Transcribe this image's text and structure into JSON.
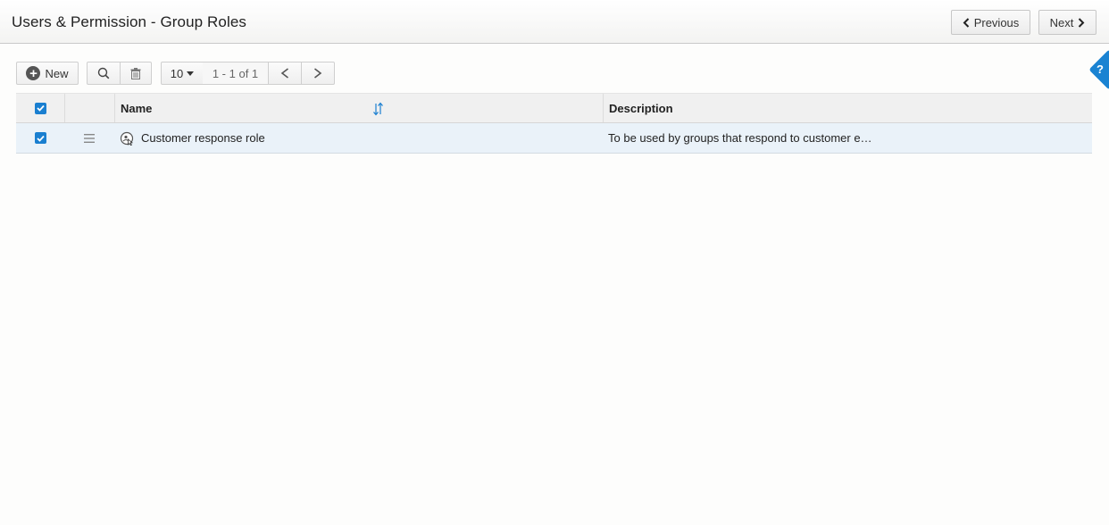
{
  "header": {
    "title": "Users & Permission - Group Roles",
    "previous_label": "Previous",
    "next_label": "Next"
  },
  "toolbar": {
    "new_label": "New",
    "page_size": "10",
    "pager_text": "1 - 1 of 1"
  },
  "help": {
    "label": "?"
  },
  "grid": {
    "columns": [
      "Name",
      "Description"
    ],
    "header_checked": true,
    "rows": [
      {
        "checked": true,
        "name": "Customer response role",
        "description": "To be used by groups that respond to customer e…"
      }
    ]
  },
  "colors": {
    "accent": "#1a7fd0",
    "selected_row": "#eaf2f9"
  }
}
